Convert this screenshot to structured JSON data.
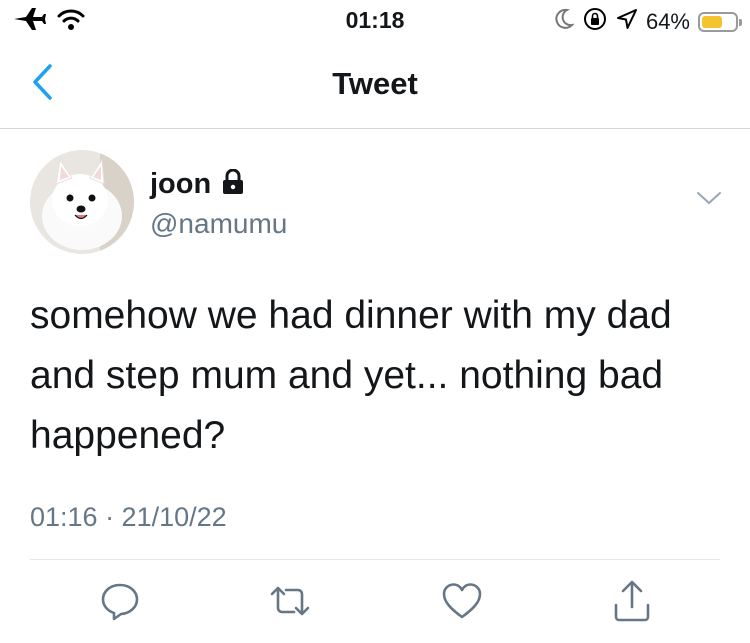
{
  "status_bar": {
    "time": "01:18",
    "battery_text": "64%",
    "battery_level": 0.64,
    "icons": [
      "airplane-icon",
      "wifi-icon",
      "moon-icon",
      "orientation-lock-icon",
      "location-icon",
      "battery-icon"
    ]
  },
  "nav": {
    "title": "Tweet",
    "back_icon": "chevron-left-icon"
  },
  "tweet": {
    "display_name": "joon",
    "handle": "@namumu",
    "protected": true,
    "text": "somehow we had dinner with my dad and step mum and yet... nothing bad happened?",
    "timestamp": "01:16 · 21/10/22"
  },
  "actions": [
    {
      "name": "reply-button",
      "icon": "comment-icon"
    },
    {
      "name": "retweet-button",
      "icon": "retweet-icon"
    },
    {
      "name": "like-button",
      "icon": "heart-icon"
    },
    {
      "name": "share-button",
      "icon": "share-icon"
    }
  ],
  "colors": {
    "accent": "#1da1f2",
    "secondary_text": "#657786",
    "icon_gray": "#657786",
    "battery_fill": "#f4c430"
  }
}
